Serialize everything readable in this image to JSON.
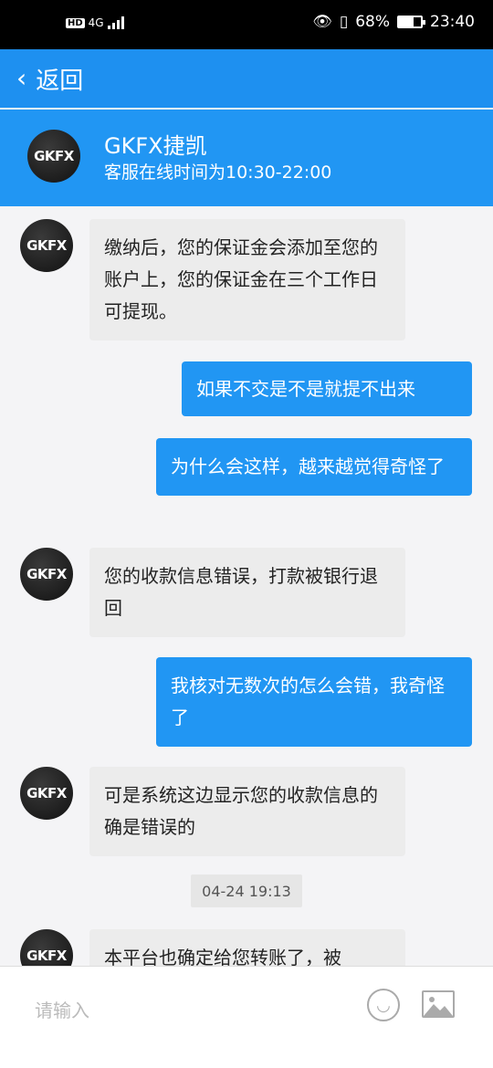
{
  "status_bar": {
    "network": "4G",
    "battery_percent": "68%",
    "battery_level": 0.68,
    "time": "23:40"
  },
  "nav": {
    "back_label": "返回"
  },
  "contact": {
    "avatar_text": "GKFX",
    "name": "GKFX捷凯",
    "hours": "客服在线时间为10:30-22:00"
  },
  "messages": [
    {
      "sender": "agent",
      "text": "缴纳后，您的保证金会添加至您的账户上，您的保证金在三个工作日可提现。"
    },
    {
      "sender": "user",
      "text": "如果不交是不是就提不出来"
    },
    {
      "sender": "user",
      "text": "为什么会这样，越来越觉得奇怪了"
    },
    {
      "sender": "agent",
      "text": "您的收款信息错误，打款被银行退回"
    },
    {
      "sender": "user",
      "text": "我核对无数次的怎么会错，我奇怪了"
    },
    {
      "sender": "agent",
      "text": "可是系统这边显示您的收款信息的确是错误的"
    },
    {
      "sender": "timestamp",
      "text": "04-24 19:13"
    },
    {
      "sender": "agent",
      "text": "本平台也确定给您转账了，被"
    }
  ],
  "input": {
    "placeholder": "请输入"
  },
  "icons": {
    "emoji": "emoji-icon",
    "image": "image-icon",
    "back": "chevron-left-icon"
  },
  "colors": {
    "primary": "#1e90f0",
    "card": "#2196f3",
    "incoming_bubble": "#ececec",
    "outgoing_bubble": "#2196f3"
  }
}
